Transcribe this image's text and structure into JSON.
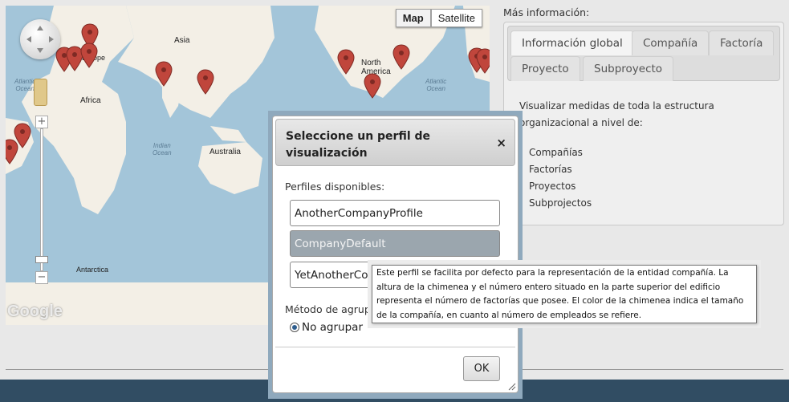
{
  "map": {
    "type_buttons": [
      {
        "label": "Map",
        "active": true
      },
      {
        "label": "Satellite",
        "active": false
      }
    ],
    "labels": {
      "asia": "Asia",
      "africa": "Africa",
      "europe": "Europe",
      "north_america": "North\nAmerica",
      "australia": "Australia",
      "antarctica": "Antarctica",
      "atlantic_ocean_left": "Atlantic\nOcean",
      "indian_ocean": "Indian\nOcean",
      "atlantic_ocean_right": "Atlantic\nOcean"
    },
    "zoom_in": "+",
    "zoom_out": "−",
    "logo": "Google",
    "marker_color": "#c0463c"
  },
  "info": {
    "heading": "Más información:",
    "tabs": [
      {
        "label": "Información global",
        "active": true
      },
      {
        "label": "Compañía",
        "active": false
      },
      {
        "label": "Factoría",
        "active": false
      },
      {
        "label": "Proyecto",
        "active": false
      },
      {
        "label": "Subproyecto",
        "active": false
      }
    ],
    "body_text": "Visualizar medidas de toda la estructura organizacional a nivel de:",
    "items": [
      "Compañías",
      "Factorías",
      "Proyectos",
      "Subprojectos"
    ]
  },
  "dialog": {
    "title": "Seleccione un perfil de visualización",
    "close": "×",
    "profiles_label": "Perfiles disponibles:",
    "profiles": [
      {
        "name": "AnotherCompanyProfile",
        "selected": false
      },
      {
        "name": "CompanyDefault",
        "selected": true
      },
      {
        "name": "YetAnotherCompanyProfile",
        "selected": false
      }
    ],
    "group_label": "Método de agrupación:",
    "group_option": "No agrupar",
    "ok_label": "OK"
  },
  "tooltip": {
    "text": "Este perfil se facilita por defecto para la representación de la entidad compañía. La altura de la chimenea y el número entero situado en la parte superior del edificio representa el número de factorías que posee. El color de la chimenea indica el tamaño de la compañía, en cuanto al número de empleados se refiere."
  },
  "colors": {
    "footer": "#314d63",
    "overlay": "#8fa9bd",
    "selected_profile": "#9ba6ae"
  }
}
